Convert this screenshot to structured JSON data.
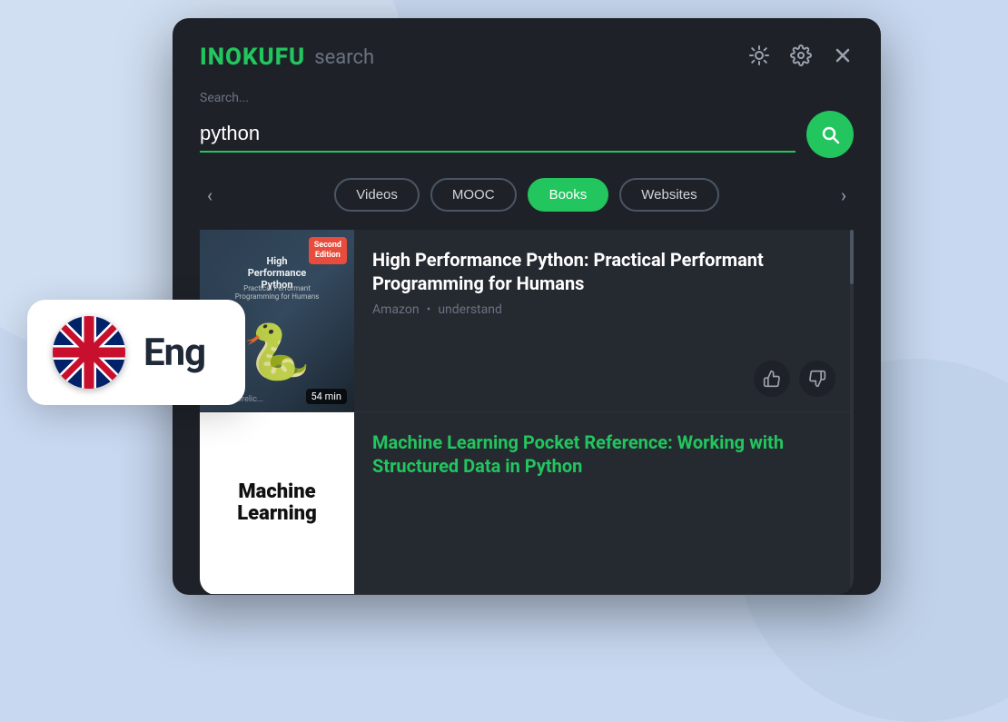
{
  "app": {
    "logo": "inokufu",
    "logo_search": "search"
  },
  "header": {
    "brightness_icon": "☀",
    "settings_icon": "⚙",
    "close_icon": "✕"
  },
  "search": {
    "placeholder": "Search...",
    "value": "python",
    "button_label": "Search"
  },
  "filters": {
    "prev_arrow": "‹",
    "next_arrow": "›",
    "tabs": [
      {
        "label": "Videos",
        "active": false
      },
      {
        "label": "MOOC",
        "active": false
      },
      {
        "label": "Books",
        "active": true
      },
      {
        "label": "Websites",
        "active": false
      }
    ]
  },
  "results": [
    {
      "book_title_cover_line1": "High Performance",
      "book_title_cover_line2": "Python",
      "cover_subtitle": "Practical Performant Programming for Humans",
      "cover_badge_line1": "Second",
      "cover_badge_line2": "Edition",
      "cover_author": "Micha Gorelic...",
      "cover_duration": "54 min",
      "title": "High Performance Python: Practical Performant Programming for Humans",
      "source": "Amazon",
      "tag": "understand",
      "title_color": "white"
    },
    {
      "cover_title_line1": "Machine",
      "cover_title_line2": "Learning",
      "title": "Machine Learning Pocket Reference: Working with Structured Data in Python",
      "source": "",
      "tag": "",
      "title_color": "green"
    }
  ],
  "actions": {
    "thumbs_up": "👍",
    "thumbs_down": "👎"
  },
  "language_badge": {
    "lang": "Eng"
  }
}
